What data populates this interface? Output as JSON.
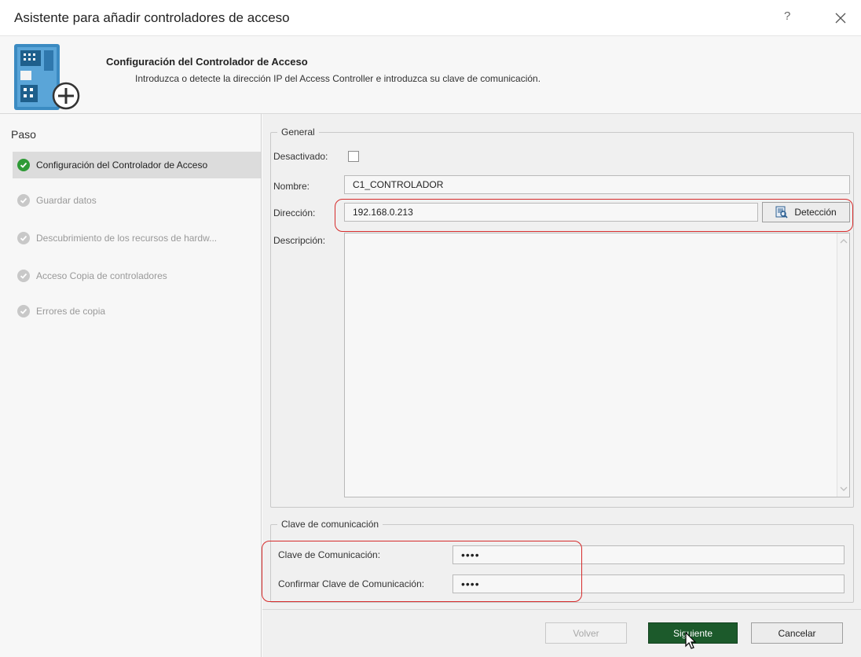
{
  "window": {
    "title": "Asistente para añadir controladores de acceso",
    "help_label": "?"
  },
  "header": {
    "title": "Configuración del Controlador de Acceso",
    "subtitle": "Introduzca o detecte la dirección IP del Access Controller e introduzca su clave de comunicación."
  },
  "sidebar": {
    "heading": "Paso",
    "steps": [
      {
        "label": "Configuración del Controlador de Acceso",
        "state": "active"
      },
      {
        "label": "Guardar datos",
        "state": "pending"
      },
      {
        "label": "Descubrimiento de los recursos de hardw...",
        "state": "pending"
      },
      {
        "label": "Acceso Copia de controladores",
        "state": "pending"
      },
      {
        "label": "Errores de copia",
        "state": "pending"
      }
    ]
  },
  "general": {
    "legend": "General",
    "disabled_label": "Desactivado:",
    "disabled_checked": false,
    "name_label": "Nombre:",
    "name_value": "C1_CONTROLADOR",
    "address_label": "Dirección:",
    "address_value": "192.168.0.213",
    "detect_button": "Detección",
    "description_label": "Descripción:",
    "description_value": ""
  },
  "communication": {
    "legend": "Clave de comunicación",
    "key_label": "Clave de Comunicación:",
    "key_value": "••••",
    "confirm_label": "Confirmar Clave de Comunicación:",
    "confirm_value": "••••"
  },
  "footer": {
    "back_label": "Volver",
    "next_label": "Siguiente",
    "cancel_label": "Cancelar"
  },
  "colors": {
    "accent_green": "#1c5a2b",
    "step_done_green": "#2e9a36",
    "highlight_red": "#d62b2b"
  }
}
